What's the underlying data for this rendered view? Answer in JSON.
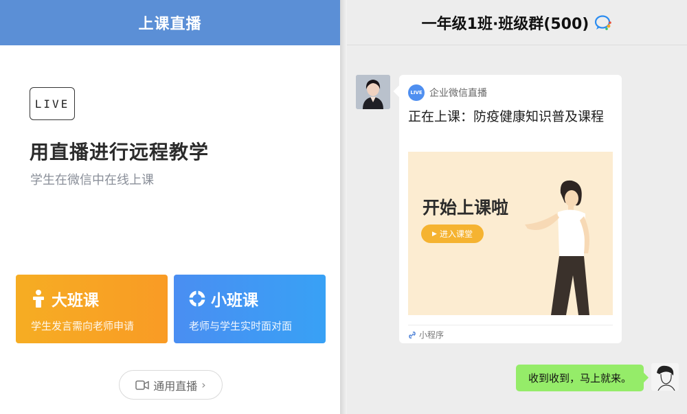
{
  "left": {
    "header_title": "上课直播",
    "live_badge": "LIVE",
    "title": "用直播进行远程教学",
    "subtitle": "学生在微信中在线上课",
    "big_class": {
      "title": "大班课",
      "desc": "学生发言需向老师申请",
      "icon": "person-icon",
      "color": "#f7a623"
    },
    "small_class": {
      "title": "小班课",
      "desc": "老师与学生实时面对面",
      "icon": "ring-icon",
      "color": "#3f97f3"
    },
    "general_live": {
      "label": "通用直播",
      "icon": "video-camera-icon"
    },
    "header_color": "#5b8fd6"
  },
  "right": {
    "chat_title": "一年级1班·班级群(500)",
    "chat_icon": "wecom-chat-icon",
    "card": {
      "source_badge": "LIVE",
      "source": "企业微信直播",
      "title": "正在上课：防疫健康知识普及课程",
      "banner_title": "开始上课啦",
      "enter_button": "进入课堂",
      "mini_program": "小程序"
    },
    "reply_text": "收到收到，马上就来。",
    "bubble_color": "#95ec69"
  }
}
